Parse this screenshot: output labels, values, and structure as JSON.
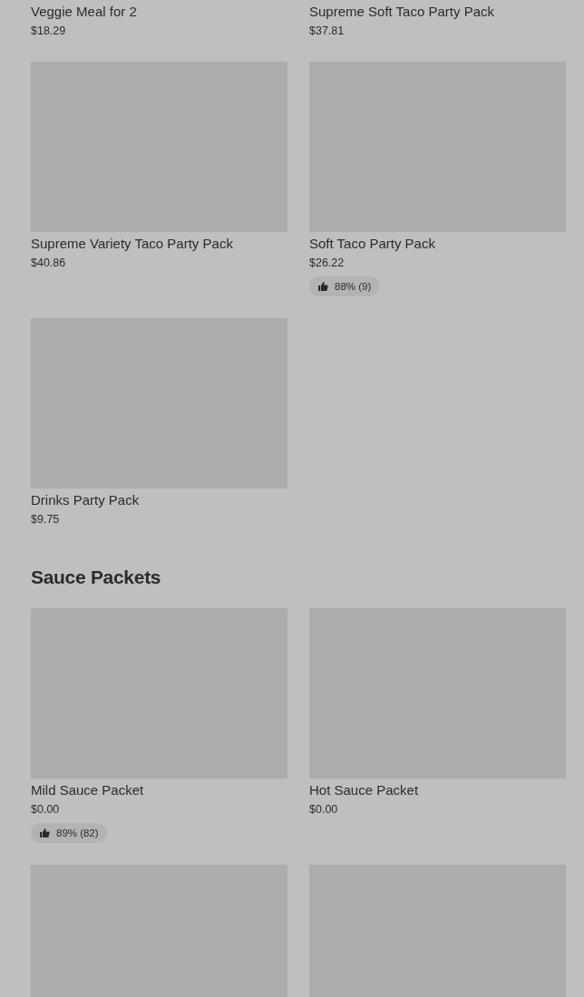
{
  "sections": [
    {
      "items": [
        {
          "name": "Veggie Meal for 2",
          "price": "$18.29"
        },
        {
          "name": "Supreme Soft Taco Party Pack",
          "price": "$37.81"
        },
        {
          "name": "Supreme Variety Taco Party Pack",
          "price": "$40.86",
          "image": true
        },
        {
          "name": "Soft Taco Party Pack",
          "price": "$26.22",
          "image": true,
          "rating": "88% (9)"
        },
        {
          "name": "Drinks Party Pack",
          "price": "$9.75",
          "image": true
        }
      ]
    },
    {
      "title": "Sauce Packets",
      "items": [
        {
          "name": "Mild Sauce Packet",
          "price": "$0.00",
          "image": true,
          "rating": "89% (82)"
        },
        {
          "name": "Hot Sauce Packet",
          "price": "$0.00",
          "image": true
        },
        {
          "image": true
        },
        {
          "image": true
        }
      ]
    }
  ]
}
